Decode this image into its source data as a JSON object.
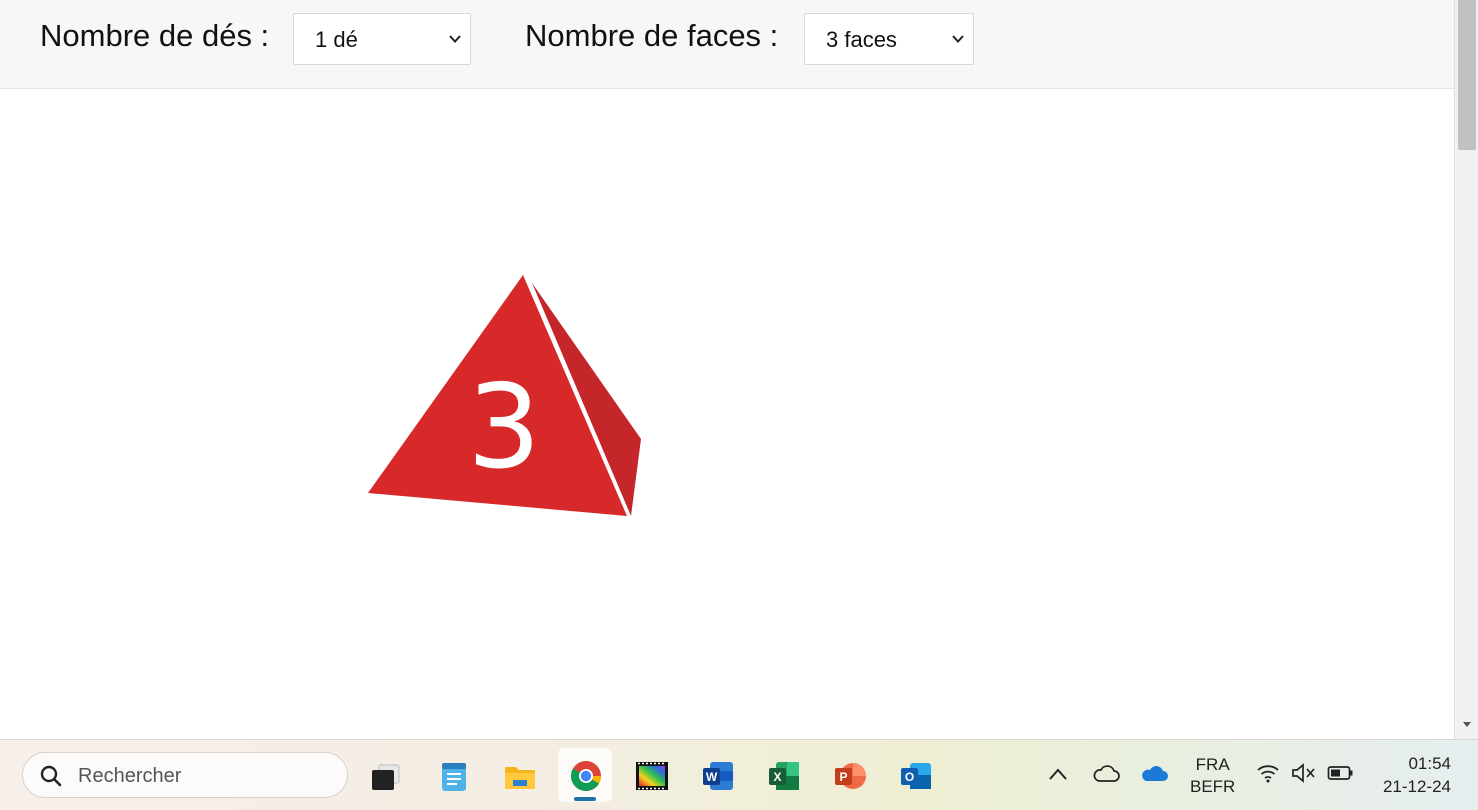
{
  "controls": {
    "dice_label": "Nombre de dés :",
    "dice_value": "1 dé",
    "faces_label": "Nombre de faces :",
    "faces_value": "3 faces"
  },
  "die": {
    "value": "3",
    "color": "#d8292a",
    "shade_color": "#c4262a",
    "number_color": "#ffffff"
  },
  "taskbar": {
    "search_placeholder": "Rechercher",
    "apps": [
      "task-view",
      "notepad",
      "file-explorer",
      "chrome",
      "media-player",
      "word",
      "excel",
      "powerpoint",
      "outlook"
    ],
    "active_app": "chrome",
    "tray": [
      "chevron-up",
      "cloud",
      "onedrive",
      "wifi",
      "volume-muted",
      "battery"
    ],
    "language": "FRA",
    "layout": "BEFR",
    "time": "01:54",
    "date": "21-12-24"
  }
}
